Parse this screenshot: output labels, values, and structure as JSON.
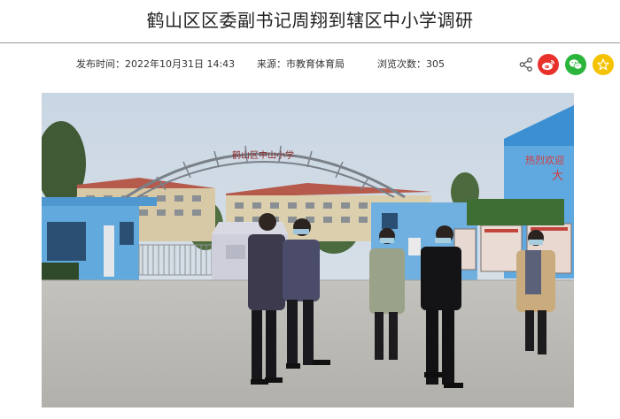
{
  "article": {
    "title": "鹤山区区委副书记周翔到辖区中小学调研",
    "published_label": "发布时间：2022年10月31日 14:43",
    "source_label": "来源：市教育体育局",
    "views_label": "浏览次数：305"
  },
  "share": {
    "icons": [
      "share-icon",
      "weibo-icon",
      "wechat-icon",
      "favorite-star-icon"
    ]
  },
  "photo": {
    "arch_sign": "鹤山区中山小学",
    "wall_sign": "热烈欢迎",
    "wall_sign2": "大"
  },
  "colors": {
    "weibo": "#e8312b",
    "wechat": "#2bb53a",
    "favorite": "#f5c200",
    "rule": "#9a9a9a"
  }
}
